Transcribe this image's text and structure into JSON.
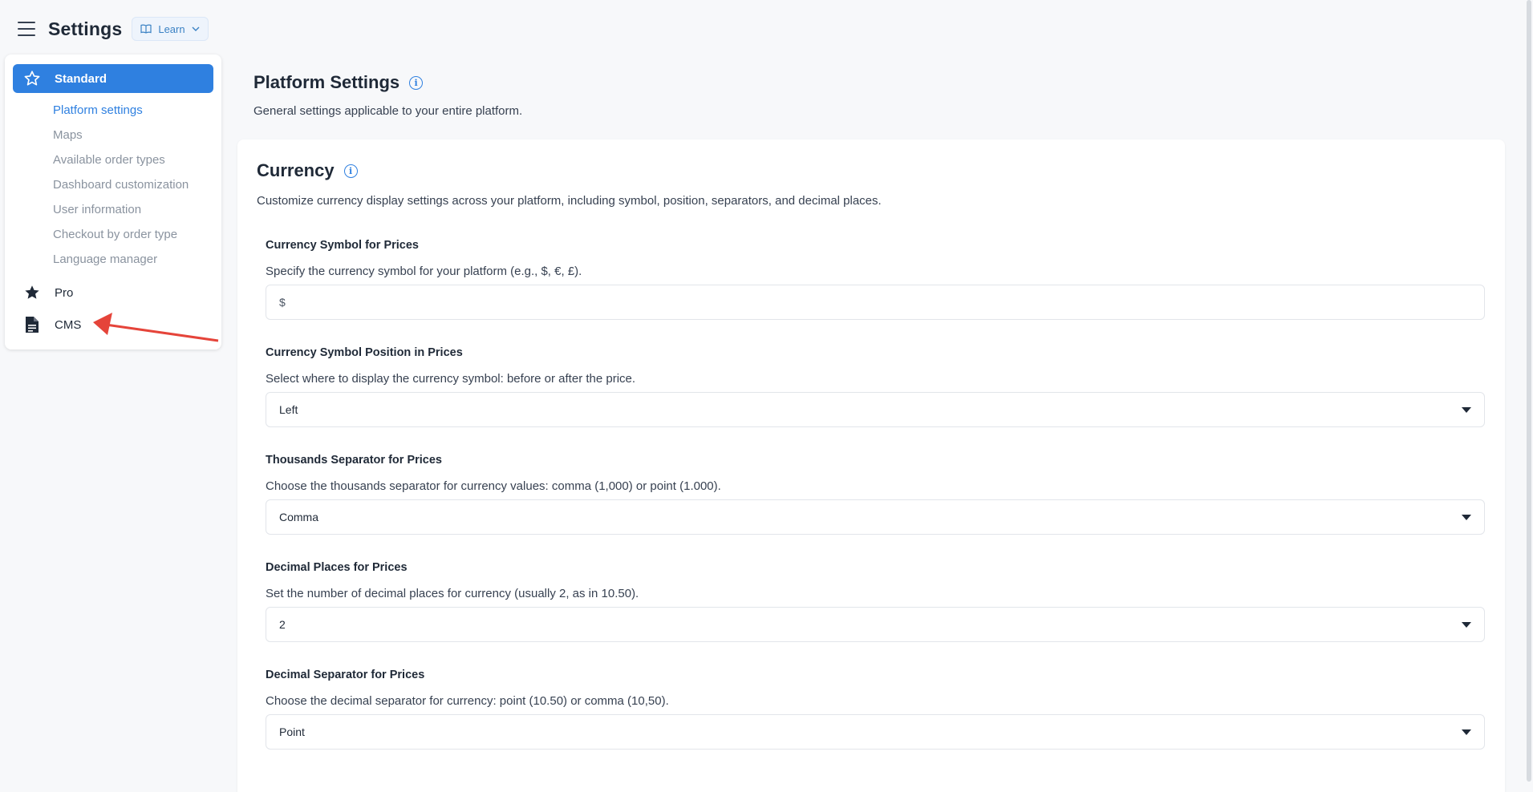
{
  "header": {
    "title": "Settings",
    "learn_label": "Learn"
  },
  "sidebar": {
    "groups": [
      {
        "label": "Standard",
        "icon": "star-outline-icon",
        "items": [
          {
            "label": "Platform settings",
            "active": true
          },
          {
            "label": "Maps"
          },
          {
            "label": "Available order types"
          },
          {
            "label": "Dashboard customization"
          },
          {
            "label": "User information"
          },
          {
            "label": "Checkout by order type"
          },
          {
            "label": "Language manager"
          }
        ]
      },
      {
        "label": "Pro",
        "icon": "star-filled-icon"
      },
      {
        "label": "CMS",
        "icon": "document-icon"
      }
    ]
  },
  "page": {
    "title": "Platform Settings",
    "subtitle": "General settings applicable to your entire platform."
  },
  "currency": {
    "title": "Currency",
    "description": "Customize currency display settings across your platform, including symbol, position, separators, and decimal places.",
    "fields": [
      {
        "label": "Currency Symbol for Prices",
        "help": "Specify the currency symbol for your platform (e.g., $, €, £).",
        "value": "$"
      },
      {
        "label": "Currency Symbol Position in Prices",
        "help": "Select where to display the currency symbol: before or after the price.",
        "value": "Left"
      },
      {
        "label": "Thousands Separator for Prices",
        "help": "Choose the thousands separator for currency values: comma (1,000) or point (1.000).",
        "value": "Comma"
      },
      {
        "label": "Decimal Places for Prices",
        "help": "Set the number of decimal places for currency (usually 2, as in 10.50).",
        "value": "2"
      },
      {
        "label": "Decimal Separator for Prices",
        "help": "Choose the decimal separator for currency: point (10.50) or comma (10,50).",
        "value": "Point"
      }
    ]
  },
  "colors": {
    "accent": "#2f80e0",
    "annotation_arrow": "#e5443a"
  }
}
